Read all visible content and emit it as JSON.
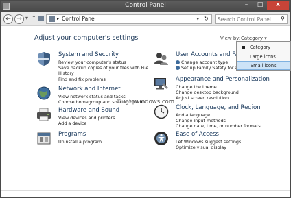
{
  "window": {
    "title": "Control Panel",
    "close": "x",
    "min": "–",
    "max": "□"
  },
  "nav": {
    "back": "←",
    "forward": "→",
    "recent": "▾",
    "up": "↑",
    "breadcrumb": "Control Panel",
    "crumb_arrow": "▸",
    "refresh": "↻",
    "dropdown": "▾",
    "search_placeholder": "Search Control Panel",
    "search_icon": "⚲"
  },
  "page_title": "Adjust your computer's settings",
  "view_by": {
    "label": "View by:",
    "value": "Category ▾"
  },
  "view_menu": [
    "Category",
    "Large icons",
    "Small icons"
  ],
  "watermark": "© intowindows.com",
  "categories": [
    {
      "title": "System and Security",
      "icon": "shield-icon",
      "links": [
        "Review your computer's status",
        "Save backup copies of your files with File",
        "History",
        "Find and fix problems"
      ]
    },
    {
      "title": "Network and Internet",
      "icon": "globe-icon",
      "links": [
        "View network status and tasks",
        "Choose homegroup and sharing options"
      ]
    },
    {
      "title": "Hardware and Sound",
      "icon": "printer-icon",
      "links": [
        "View devices and printers",
        "Add a device"
      ]
    },
    {
      "title": "Programs",
      "icon": "programs-icon",
      "links": [
        "Uninstall a program"
      ]
    },
    {
      "title": "User Accounts and Family Safety",
      "icon": "users-icon",
      "links": [
        "Change account type",
        "Set up Family Safety for any user"
      ]
    },
    {
      "title": "Appearance and Personalization",
      "icon": "monitor-icon",
      "links": [
        "Change the theme",
        "Change desktop background",
        "Adjust screen resolution"
      ]
    },
    {
      "title": "Clock, Language, and Region",
      "icon": "clock-icon",
      "links": [
        "Add a language",
        "Change input methods",
        "Change date, time, or number formats"
      ]
    },
    {
      "title": "Ease of Access",
      "icon": "ease-icon",
      "links": [
        "Let Windows suggest settings",
        "Optimize visual display"
      ]
    }
  ]
}
